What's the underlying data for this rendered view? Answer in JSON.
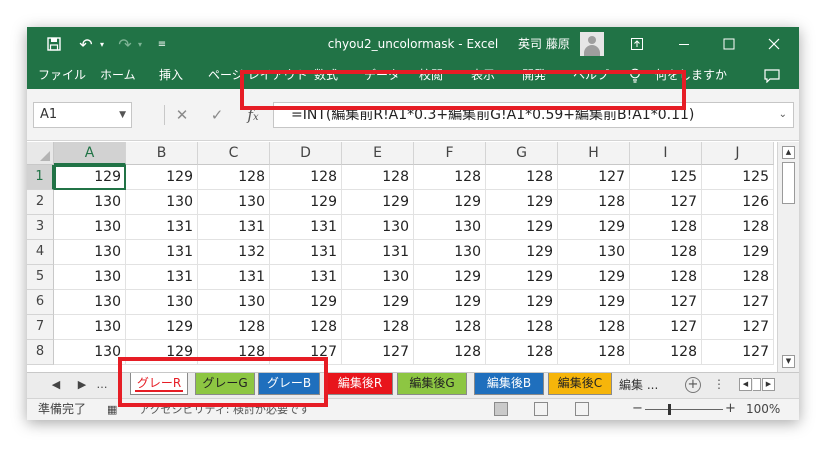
{
  "app": {
    "filename": "chyou2_uncolormask",
    "app_name": "Excel",
    "separator": "-",
    "user": "英司 藤原"
  },
  "ribbon_tabs": [
    "ファイル",
    "ホーム",
    "挿入",
    "ページ レイアウト",
    "数式",
    "データ",
    "校閲",
    "表示",
    "開発",
    "ヘルプ",
    "何をしますか"
  ],
  "formula_bar": {
    "name_box": "A1",
    "formula": "=INT(編集前R!A1*0.3+編集前G!A1*0.59+編集前B!A1*0.11)"
  },
  "grid": {
    "columns": [
      "A",
      "B",
      "C",
      "D",
      "E",
      "F",
      "G",
      "H",
      "I",
      "J"
    ],
    "rows": [
      "1",
      "2",
      "3",
      "4",
      "5",
      "6",
      "7",
      "8"
    ],
    "cells": [
      [
        "129",
        "129",
        "128",
        "128",
        "128",
        "128",
        "128",
        "127",
        "125",
        "125"
      ],
      [
        "130",
        "130",
        "130",
        "129",
        "129",
        "129",
        "129",
        "128",
        "127",
        "126"
      ],
      [
        "130",
        "131",
        "131",
        "131",
        "130",
        "130",
        "129",
        "129",
        "128",
        "128"
      ],
      [
        "130",
        "131",
        "132",
        "131",
        "131",
        "130",
        "129",
        "130",
        "128",
        "129"
      ],
      [
        "130",
        "131",
        "131",
        "131",
        "130",
        "129",
        "129",
        "129",
        "128",
        "128"
      ],
      [
        "130",
        "130",
        "130",
        "129",
        "129",
        "129",
        "129",
        "129",
        "127",
        "127"
      ],
      [
        "130",
        "129",
        "128",
        "128",
        "128",
        "128",
        "128",
        "128",
        "127",
        "127"
      ],
      [
        "130",
        "129",
        "128",
        "127",
        "127",
        "128",
        "128",
        "128",
        "128",
        "127"
      ]
    ]
  },
  "sheet_tabs": [
    {
      "label": "グレーR",
      "color": "#ffffff",
      "active": true
    },
    {
      "label": "グレーG",
      "color": "#8dc642"
    },
    {
      "label": "グレーB",
      "color": "#1f6fbd"
    },
    {
      "label": "編集後R",
      "color": "#e8151b"
    },
    {
      "label": "編集後G",
      "color": "#8dc642"
    },
    {
      "label": "編集後B",
      "color": "#1f6fbd"
    },
    {
      "label": "編集後C",
      "color": "#f6b50a"
    }
  ],
  "sheet_more": "編集 ...",
  "status": {
    "ready": "準備完了",
    "accessibility": "アクセシビリティ: 検討が必要です",
    "zoom": "100%"
  },
  "colors": {
    "excel_green": "#217346",
    "highlight_red": "#e61d25"
  }
}
